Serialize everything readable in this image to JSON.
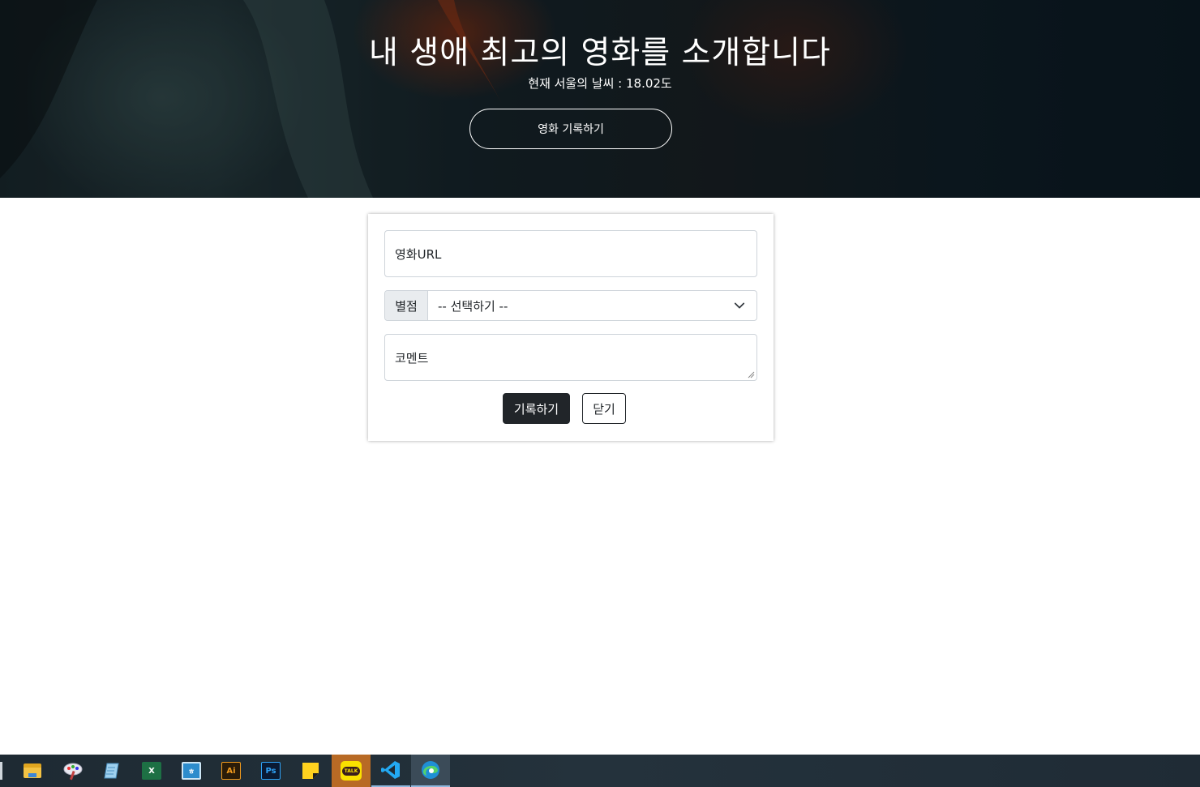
{
  "hero": {
    "title": "내 생애 최고의 영화를 소개합니다",
    "weather": "현재 서울의 날씨 : 18.02도",
    "record_button": "영화 기록하기"
  },
  "form": {
    "url_placeholder": "영화URL",
    "rating_label": "별점",
    "rating_selected": "-- 선택하기 --",
    "comment_placeholder": "코멘트",
    "save_button": "기록하기",
    "close_button": "닫기"
  },
  "taskbar": {
    "icons": [
      "file-explorer-icon",
      "paint-app-icon",
      "notepad-icon",
      "excel-icon",
      "hangul-word-icon",
      "illustrator-icon",
      "photoshop-icon",
      "sticky-notes-icon",
      "kakaotalk-icon",
      "vscode-icon",
      "edge-browser-icon"
    ],
    "icon_text": {
      "excel": "X",
      "illustrator": "Ai",
      "photoshop": "Ps",
      "kakaotalk": "TALK"
    }
  },
  "colors": {
    "dark_button": "#212529",
    "input_border": "#ced4da",
    "addon_bg": "#e9ecef"
  }
}
